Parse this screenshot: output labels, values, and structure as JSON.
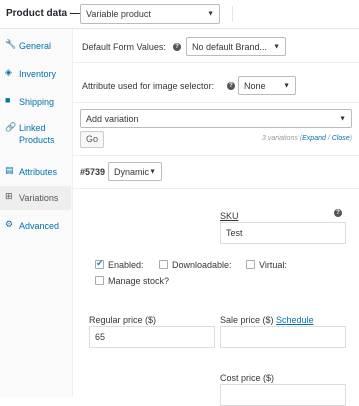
{
  "header": {
    "title": "Product data —",
    "product_type": "Variable product",
    "caret": "▼"
  },
  "sidebar": {
    "items": [
      {
        "label": "General",
        "icon": "🔧",
        "icon_name": "wrench-icon"
      },
      {
        "label": "Inventory",
        "icon": "◈",
        "icon_name": "inventory-icon"
      },
      {
        "label": "Shipping",
        "icon": "■",
        "icon_name": "truck-icon"
      },
      {
        "label": "Linked Products",
        "icon": "🔗",
        "icon_name": "link-icon"
      },
      {
        "label": "Attributes",
        "icon": "▤",
        "icon_name": "list-icon"
      },
      {
        "label": "Variations",
        "icon": "⊞",
        "icon_name": "grid-icon"
      },
      {
        "label": "Advanced",
        "icon": "⚙",
        "icon_name": "gear-icon"
      }
    ]
  },
  "defaults": {
    "form_values_label": "Default Form Values:",
    "form_values_select": "No default Brand...",
    "image_selector_label": "Attribute used for image selector:",
    "image_selector_select": "None"
  },
  "variations": {
    "add_select": "Add variation",
    "go_button": "Go",
    "count_text": "3 variations",
    "expand": "Expand",
    "slash": "/",
    "close": "Close",
    "open_paren": "(",
    "close_paren": ")"
  },
  "variation": {
    "id": "#5739",
    "attr_select": "Dynamic",
    "sku_label": "SKU",
    "sku_value": "Test",
    "enabled_label": "Enabled:",
    "enabled_checked": true,
    "downloadable_label": "Downloadable:",
    "virtual_label": "Virtual:",
    "manage_stock_label": "Manage stock?",
    "regular_price_label": "Regular price ($)",
    "regular_price_value": "65",
    "sale_price_label": "Sale price ($)",
    "schedule_link": "Schedule",
    "cost_price_label": "Cost price ($)"
  },
  "colors": {
    "link": "#0073aa",
    "check": "#1e8cbe"
  }
}
